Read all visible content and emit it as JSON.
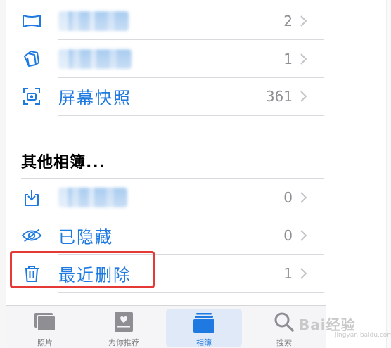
{
  "albums": [
    {
      "name": "",
      "count": "2",
      "icon": "panorama-icon",
      "blurred": true
    },
    {
      "name": "",
      "count": "1",
      "icon": "burst-icon",
      "blurred": true
    },
    {
      "name": "屏幕快照",
      "count": "361",
      "icon": "screenshot-icon",
      "blurred": false
    }
  ],
  "other_section": {
    "title": "其他相簿...",
    "items": [
      {
        "name": "",
        "count": "0",
        "icon": "import-icon",
        "blurred": true
      },
      {
        "name": "已隐藏",
        "count": "0",
        "icon": "hidden-eye-icon",
        "blurred": false
      },
      {
        "name": "最近删除",
        "count": "1",
        "icon": "trash-icon",
        "blurred": false
      }
    ]
  },
  "tabbar": {
    "tabs": [
      {
        "label": "照片",
        "icon": "photos-tab-icon",
        "active": false
      },
      {
        "label": "为你推荐",
        "icon": "for-you-tab-icon",
        "active": false
      },
      {
        "label": "相簿",
        "icon": "albums-tab-icon",
        "active": true
      },
      {
        "label": "搜索",
        "icon": "search-tab-icon",
        "active": false
      }
    ]
  },
  "watermark": {
    "text": "Bai经验",
    "sub": "jingyan.baidu.com"
  },
  "colors": {
    "accent": "#1e7ae0",
    "highlight_box": "#e53935",
    "count_grey": "#8e8e93"
  }
}
